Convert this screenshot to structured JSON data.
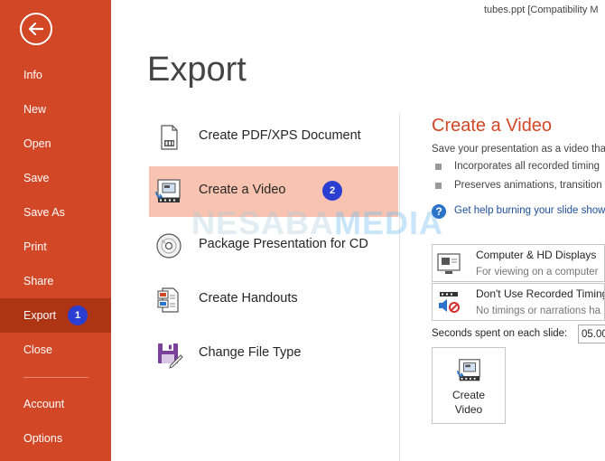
{
  "window": {
    "title": "tubes.ppt [Compatibility M"
  },
  "sidebar": {
    "items": [
      {
        "label": "Info"
      },
      {
        "label": "New"
      },
      {
        "label": "Open"
      },
      {
        "label": "Save"
      },
      {
        "label": "Save As"
      },
      {
        "label": "Print"
      },
      {
        "label": "Share"
      },
      {
        "label": "Export",
        "badge": "1"
      },
      {
        "label": "Close"
      },
      {
        "label": "Account"
      },
      {
        "label": "Options"
      }
    ],
    "active_item": "Export",
    "background_color": "#d24726"
  },
  "main": {
    "title": "Export",
    "options": [
      {
        "label": "Create PDF/XPS Document",
        "icon": "pdf-document-icon"
      },
      {
        "label": "Create a Video",
        "icon": "video-icon",
        "badge": "2",
        "selected": true
      },
      {
        "label": "Package Presentation for CD",
        "icon": "cd-icon"
      },
      {
        "label": "Create Handouts",
        "icon": "handouts-icon"
      },
      {
        "label": "Change File Type",
        "icon": "change-file-type-icon"
      }
    ]
  },
  "watermark": {
    "part1": "NESABA",
    "part2": "MEDIA"
  },
  "detail": {
    "title": "Create a Video",
    "description": "Save your presentation as a video tha",
    "bullets": [
      "Incorporates all recorded timing",
      "Preserves animations, transition"
    ],
    "help_link": "Get help burning your slide show",
    "quality_dropdown": {
      "title": "Computer & HD Displays",
      "subtitle": "For viewing on a computer"
    },
    "timing_dropdown": {
      "title": "Don't Use Recorded Timing",
      "subtitle": "No timings or narrations ha"
    },
    "seconds_label": "Seconds spent on each slide:",
    "seconds_value": "05.00",
    "create_button": "Create\nVideo"
  },
  "colors": {
    "accent": "#d24726",
    "selected_bg": "#f8c3b0",
    "badge": "#2a3fd1",
    "link": "#1e4e9c"
  }
}
